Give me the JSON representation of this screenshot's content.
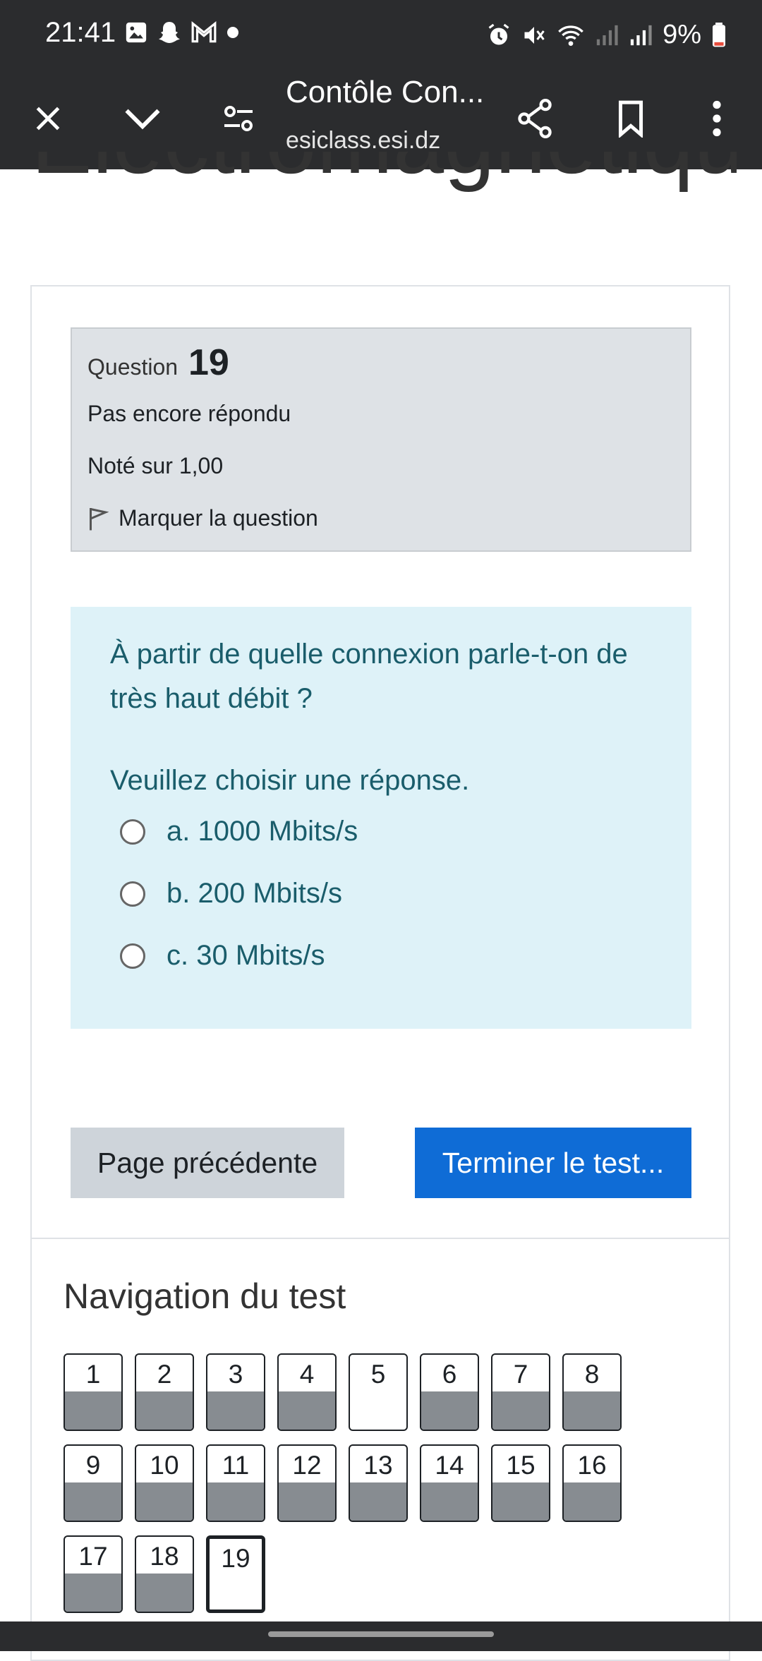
{
  "status_bar": {
    "time": "21:41",
    "battery": "9%",
    "icons_left": [
      "image-icon",
      "snapchat-icon",
      "gmail-icon",
      "dot-icon"
    ],
    "icons_right": [
      "alarm-icon",
      "mute-icon",
      "wifi-icon",
      "signal-icon",
      "signal-icon",
      "battery-icon"
    ]
  },
  "browser": {
    "title": "Contôle Con...",
    "domain": "esiclass.esi.dz"
  },
  "page": {
    "cut_heading": "Electromagnetiques_C"
  },
  "question_info": {
    "question_label": "Question",
    "question_number": "19",
    "state": "Pas encore répondu",
    "grade": "Noté sur 1,00",
    "flag_label": "Marquer la question"
  },
  "question": {
    "text": " À partir de quelle connexion parle-t-on de très haut débit ?",
    "prompt": "Veuillez choisir une réponse.",
    "options": [
      {
        "label": "a. 1000 Mbits/s",
        "selected": false
      },
      {
        "label": "b. 200 Mbits/s",
        "selected": false
      },
      {
        "label": "c. 30 Mbits/s",
        "selected": false
      }
    ]
  },
  "buttons": {
    "previous": "Page précédente",
    "finish": "Terminer le test..."
  },
  "navigation": {
    "title": "Navigation du test",
    "questions": [
      {
        "n": "1",
        "answered": true
      },
      {
        "n": "2",
        "answered": true
      },
      {
        "n": "3",
        "answered": true
      },
      {
        "n": "4",
        "answered": true
      },
      {
        "n": "5",
        "answered": false
      },
      {
        "n": "6",
        "answered": true
      },
      {
        "n": "7",
        "answered": true
      },
      {
        "n": "8",
        "answered": true
      },
      {
        "n": "9",
        "answered": true
      },
      {
        "n": "10",
        "answered": true
      },
      {
        "n": "11",
        "answered": true
      },
      {
        "n": "12",
        "answered": true
      },
      {
        "n": "13",
        "answered": true
      },
      {
        "n": "14",
        "answered": true
      },
      {
        "n": "15",
        "answered": true
      },
      {
        "n": "16",
        "answered": true
      },
      {
        "n": "17",
        "answered": true
      },
      {
        "n": "18",
        "answered": true
      },
      {
        "n": "19",
        "answered": false,
        "current": true
      }
    ]
  },
  "colors": {
    "chrome": "#2b2c2e",
    "question_bg": "#def2f8",
    "question_text": "#1a5d6b",
    "finish_button": "#0f6cd6",
    "answered_fill": "#878c91"
  }
}
